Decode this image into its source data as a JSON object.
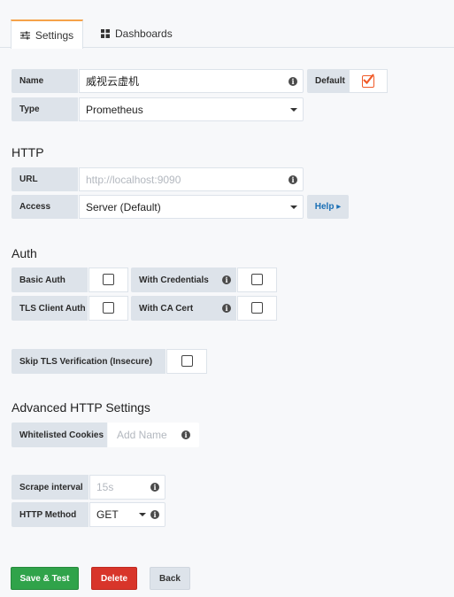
{
  "tabs": [
    {
      "label": "Settings",
      "icon": "sliders-icon"
    },
    {
      "label": "Dashboards",
      "icon": "grid-icon"
    }
  ],
  "basic": {
    "name_label": "Name",
    "name_value": "威视云虚机",
    "default_label": "Default",
    "default_checked": true,
    "type_label": "Type",
    "type_value": "Prometheus"
  },
  "http": {
    "title": "HTTP",
    "url_label": "URL",
    "url_placeholder": "http://localhost:9090",
    "access_label": "Access",
    "access_value": "Server (Default)",
    "help_label": "Help ▸"
  },
  "auth": {
    "title": "Auth",
    "basic_auth_label": "Basic Auth",
    "with_credentials_label": "With Credentials",
    "tls_client_auth_label": "TLS Client Auth",
    "with_ca_cert_label": "With CA Cert",
    "skip_tls_label": "Skip TLS Verification (Insecure)"
  },
  "advanced": {
    "title": "Advanced HTTP Settings",
    "cookies_label": "Whitelisted Cookies",
    "cookies_placeholder": "Add Name"
  },
  "scrape": {
    "interval_label": "Scrape interval",
    "interval_placeholder": "15s",
    "method_label": "HTTP Method",
    "method_value": "GET"
  },
  "buttons": {
    "save": "Save & Test",
    "delete": "Delete",
    "back": "Back"
  },
  "colors": {
    "accent": "#f6a24a",
    "checkbox_checked": "#f05a28",
    "save_bg": "#30a34a",
    "delete_bg": "#d8352a",
    "link": "#1a6fb5"
  }
}
